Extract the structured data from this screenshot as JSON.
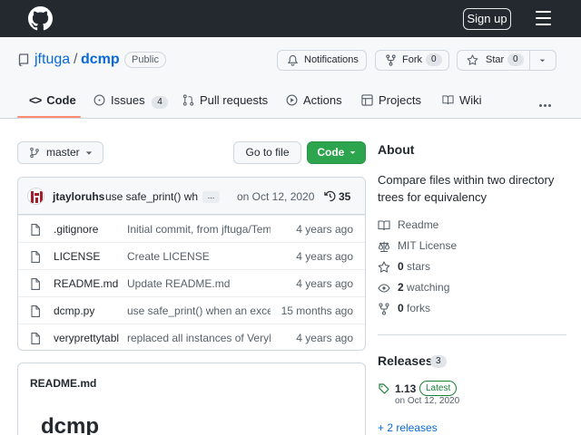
{
  "topbar": {
    "signin_label": "Sign up"
  },
  "repo": {
    "owner": "jftuga",
    "slash": "/",
    "name": "dcmp",
    "visibility": "Public"
  },
  "actions": {
    "notifications_label": "Notifications",
    "fork_label": "Fork",
    "fork_count": "0",
    "star_label": "Star",
    "star_count": "0"
  },
  "tabs": [
    {
      "label": "Code"
    },
    {
      "label": "Issues",
      "count": "4"
    },
    {
      "label": "Pull requests"
    },
    {
      "label": "Actions"
    },
    {
      "label": "Projects"
    },
    {
      "label": "Wiki"
    }
  ],
  "toolbar": {
    "branch": "master",
    "goto_file": "Go to file",
    "code_label": "Code"
  },
  "commit": {
    "author": "jtayloruhs",
    "message": "use safe_print() when an exception occurs",
    "ellipsis": "...",
    "date": "on Oct 12, 2020",
    "count": "35"
  },
  "files": [
    {
      "name": ".gitignore",
      "message": "Initial commit, from jftuga/Template",
      "date": "4 years ago",
      "type": "file"
    },
    {
      "name": "LICENSE",
      "message": "Create LICENSE",
      "date": "4 years ago",
      "type": "file"
    },
    {
      "name": "README.md",
      "message": "Update README.md",
      "date": "4 years ago",
      "type": "file"
    },
    {
      "name": "dcmp.py",
      "message": "use safe_print() when an exception occurs",
      "date": "15 months ago",
      "type": "file"
    },
    {
      "name": "veryprettytable.py",
      "message": "replaced all instances of VeryPrettyTable",
      "date": "4 years ago",
      "type": "file"
    }
  ],
  "readme": {
    "title": "README.md",
    "heading": "dcmp"
  },
  "about": {
    "heading": "About",
    "description": "Compare files within two directory trees for equivalency",
    "readme_label": "Readme",
    "license_label": "MIT License",
    "stars_count": "0",
    "stars_label": "stars",
    "watching_count": "2",
    "watching_label": "watching",
    "forks_count": "0",
    "forks_label": "forks"
  },
  "releases": {
    "heading": "Releases",
    "count": "3",
    "latest_version": "1.13",
    "latest_badge": "Latest",
    "latest_date": "on Oct 12, 2020",
    "more_label": "+ 2 releases"
  },
  "colors": {
    "accent_green": "#2da44e",
    "link_blue": "#0969da",
    "tab_underline": "#fd8c73",
    "topbar_bg": "#24292f"
  }
}
